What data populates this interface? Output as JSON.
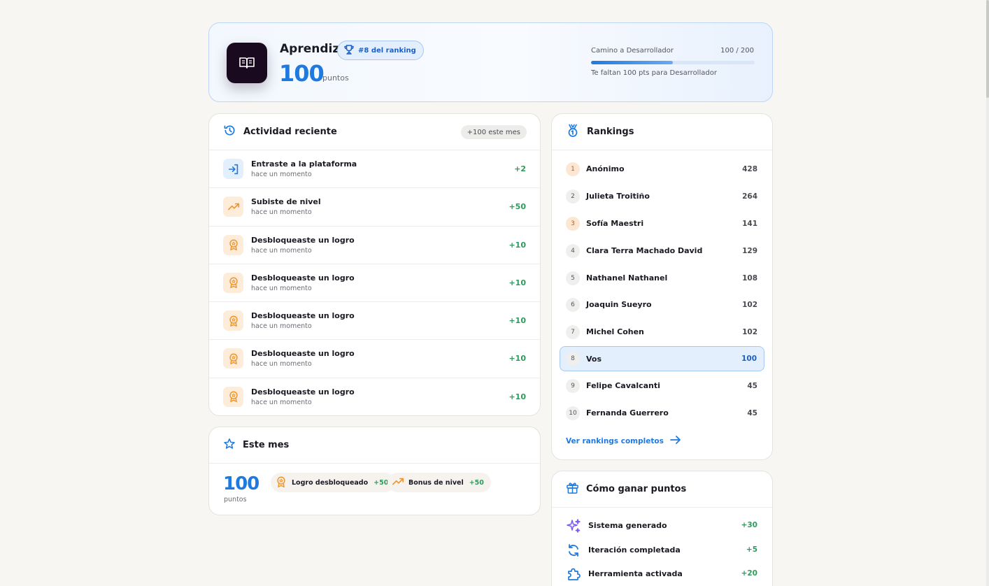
{
  "header": {
    "level_name": "Aprendiz",
    "rank_badge": "#8 del ranking",
    "points": "100",
    "points_unit": "puntos",
    "progress_label": "Camino a Desarrollador",
    "progress_value": "100 / 200",
    "progress_fraction": 0.5,
    "progress_sub": "Te faltan 100 pts para Desarrollador"
  },
  "activity": {
    "title": "Actividad reciente",
    "badge": "+100 este mes",
    "items": [
      {
        "title": "Entraste a la plataforma",
        "time": "hace un momento",
        "points": "+2",
        "icon": "login-icon"
      },
      {
        "title": "Subiste de nivel",
        "time": "hace un momento",
        "points": "+50",
        "icon": "trending-up-icon"
      },
      {
        "title": "Desbloqueaste un logro",
        "time": "hace un momento",
        "points": "+10",
        "icon": "award-icon"
      },
      {
        "title": "Desbloqueaste un logro",
        "time": "hace un momento",
        "points": "+10",
        "icon": "award-icon"
      },
      {
        "title": "Desbloqueaste un logro",
        "time": "hace un momento",
        "points": "+10",
        "icon": "award-icon"
      },
      {
        "title": "Desbloqueaste un logro",
        "time": "hace un momento",
        "points": "+10",
        "icon": "award-icon"
      },
      {
        "title": "Desbloqueaste un logro",
        "time": "hace un momento",
        "points": "+10",
        "icon": "award-icon"
      }
    ]
  },
  "month": {
    "title": "Este mes",
    "points": "100",
    "unit": "puntos",
    "chips": [
      {
        "label": "Logro desbloqueado",
        "points": "+50",
        "icon": "award-icon"
      },
      {
        "label": "Bonus de nivel",
        "points": "+50",
        "icon": "trending-up-icon"
      }
    ]
  },
  "rankings": {
    "title": "Rankings",
    "rows": [
      {
        "pos": "1",
        "name": "Anónimo",
        "score": "428"
      },
      {
        "pos": "2",
        "name": "Julieta Troitiño",
        "score": "264"
      },
      {
        "pos": "3",
        "name": "Sofía Maestri",
        "score": "141"
      },
      {
        "pos": "4",
        "name": "Clara Terra Machado David",
        "score": "129"
      },
      {
        "pos": "5",
        "name": "Nathanel Nathanel",
        "score": "108"
      },
      {
        "pos": "6",
        "name": "Joaquin Sueyro",
        "score": "102"
      },
      {
        "pos": "7",
        "name": "Michel Cohen",
        "score": "102"
      },
      {
        "pos": "8",
        "name": "Vos",
        "score": "100"
      },
      {
        "pos": "9",
        "name": "Felipe Cavalcanti",
        "score": "45"
      },
      {
        "pos": "10",
        "name": "Fernanda Guerrero",
        "score": "45"
      }
    ],
    "link": "Ver rankings completos"
  },
  "earn": {
    "title": "Cómo ganar puntos",
    "items": [
      {
        "label": "Sistema generado",
        "points": "+30",
        "icon": "sparkles-icon"
      },
      {
        "label": "Iteración completada",
        "points": "+5",
        "icon": "refresh-icon"
      },
      {
        "label": "Herramienta activada",
        "points": "+20",
        "icon": "puzzle-icon"
      }
    ]
  },
  "colors": {
    "accent": "#1f7ae0",
    "positive": "#2f9a5c",
    "orange": "#f0942a",
    "purple": "#7b5cf0"
  }
}
